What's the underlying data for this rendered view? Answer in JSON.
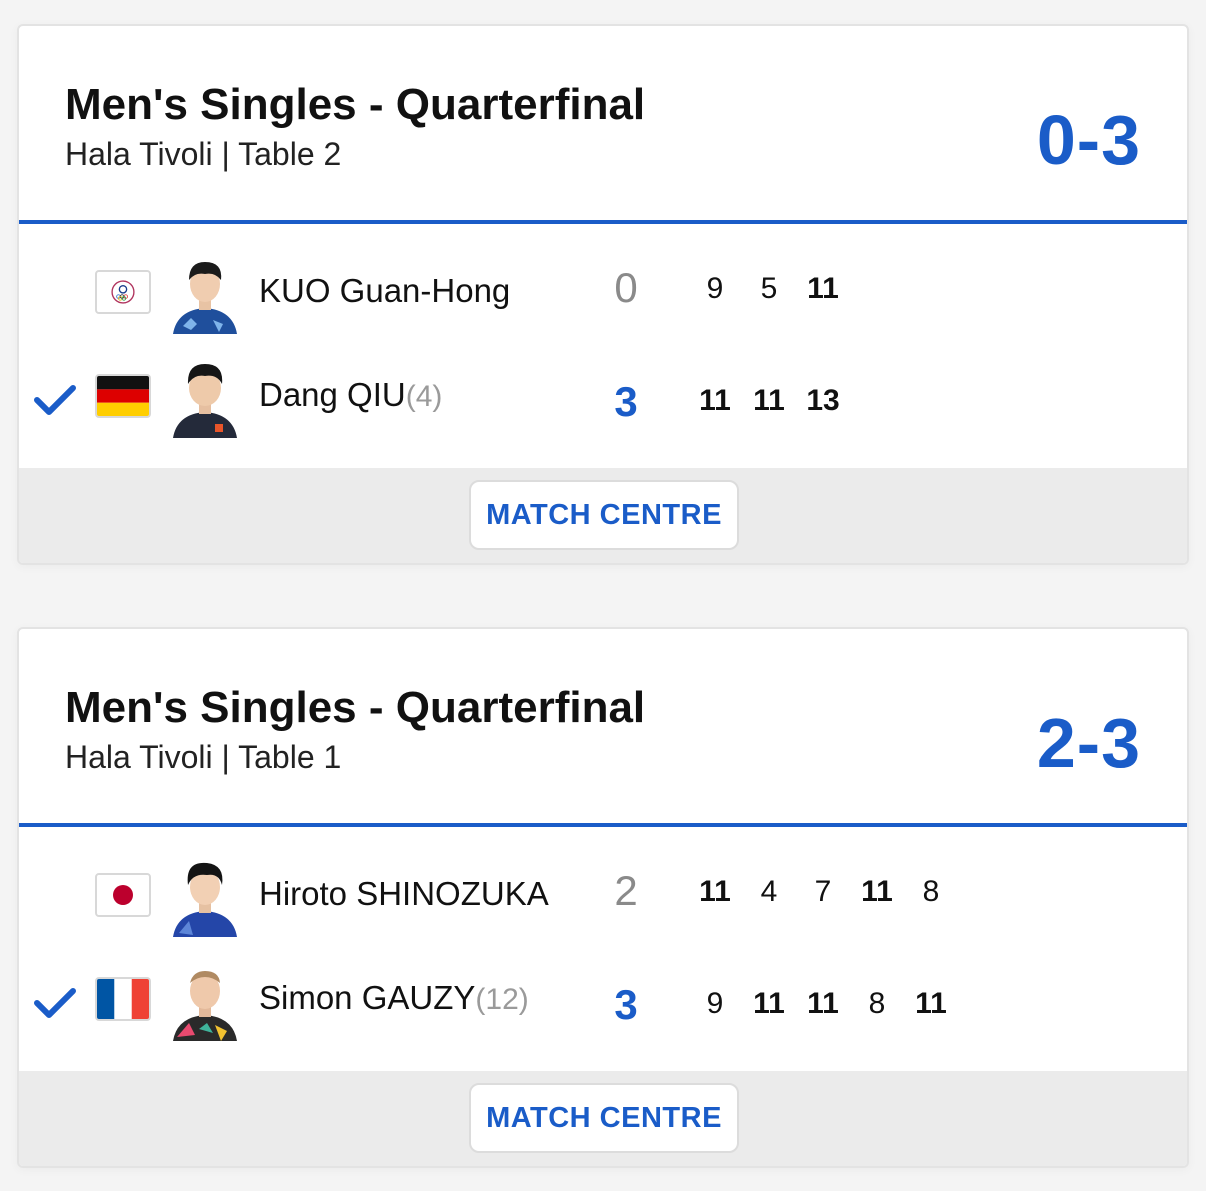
{
  "matches": [
    {
      "title": "Men's Singles - Quarterfinal",
      "venue": "Hala Tivoli | Table 2",
      "score": "0-3",
      "players": [
        {
          "name": "KUO Guan-Hong",
          "seed": "",
          "games": "0",
          "flag": "chinese-taipei-flag",
          "sets": [
            "9",
            "5",
            "11"
          ],
          "winner": false
        },
        {
          "name": "Dang QIU",
          "seed": "(4)",
          "games": "3",
          "flag": "germany-flag",
          "sets": [
            "11",
            "11",
            "13"
          ],
          "winner": true
        }
      ],
      "button": "MATCH CENTRE"
    },
    {
      "title": "Men's Singles - Quarterfinal",
      "venue": "Hala Tivoli | Table 1",
      "score": "2-3",
      "players": [
        {
          "name": "Hiroto SHINOZUKA",
          "seed": "",
          "games": "2",
          "flag": "japan-flag",
          "sets": [
            "11",
            "4",
            "7",
            "11",
            "8"
          ],
          "winner": false
        },
        {
          "name": "Simon GAUZY",
          "seed": "(12)",
          "games": "3",
          "flag": "france-flag",
          "sets": [
            "9",
            "11",
            "11",
            "8",
            "11"
          ],
          "winner": true
        }
      ],
      "button": "MATCH CENTRE"
    }
  ],
  "colors": {
    "accent": "#1a5cc8",
    "footer": "#ebebeb",
    "loser_games": "#8a8a8a"
  },
  "icons": {
    "winner": "checkmark-icon"
  }
}
